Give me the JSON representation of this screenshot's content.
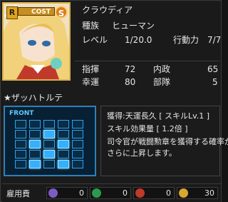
{
  "card": {
    "rarity_letter": "R",
    "cost_label": "COST",
    "cost_grade": "S"
  },
  "character": {
    "name": "クラウディア",
    "race_label": "種族",
    "race_value": "ヒューマン",
    "level_label": "レベル",
    "level_value": "1/20.0",
    "ap_label": "行動力",
    "ap_value": "7/7"
  },
  "stats": {
    "command_label": "指揮",
    "command_value": "72",
    "domestic_label": "内政",
    "domestic_value": "65",
    "luck_label": "幸運",
    "luck_value": "80",
    "units_label": "部隊",
    "units_value": "5"
  },
  "skill": {
    "title": "★ザッハトルテ",
    "formation_label": "FRONT",
    "formation_on": [
      [
        2,
        1
      ],
      [
        1,
        2
      ],
      [
        3,
        2
      ],
      [
        2,
        3
      ],
      [
        1,
        4
      ],
      [
        3,
        4
      ]
    ],
    "lines": [
      "獲得:天運長久 [ スキルLv.1 ]",
      "スキル効果量 [ 1.2倍 ]",
      "司令官が戦闘勲章を獲得する確率が",
      "さらに上昇します。"
    ]
  },
  "footer": {
    "employment_label": "雇用費",
    "resources": [
      {
        "icon": "purple-gem-icon",
        "color": "#7b5cc2",
        "value": "0"
      },
      {
        "icon": "green-gem-icon",
        "color": "#2c9a4d",
        "value": "0"
      },
      {
        "icon": "red-gem-icon",
        "color": "#c0392b",
        "value": "0"
      },
      {
        "icon": "gold-coin-icon",
        "color": "#d8a72f",
        "value": "30"
      }
    ]
  }
}
